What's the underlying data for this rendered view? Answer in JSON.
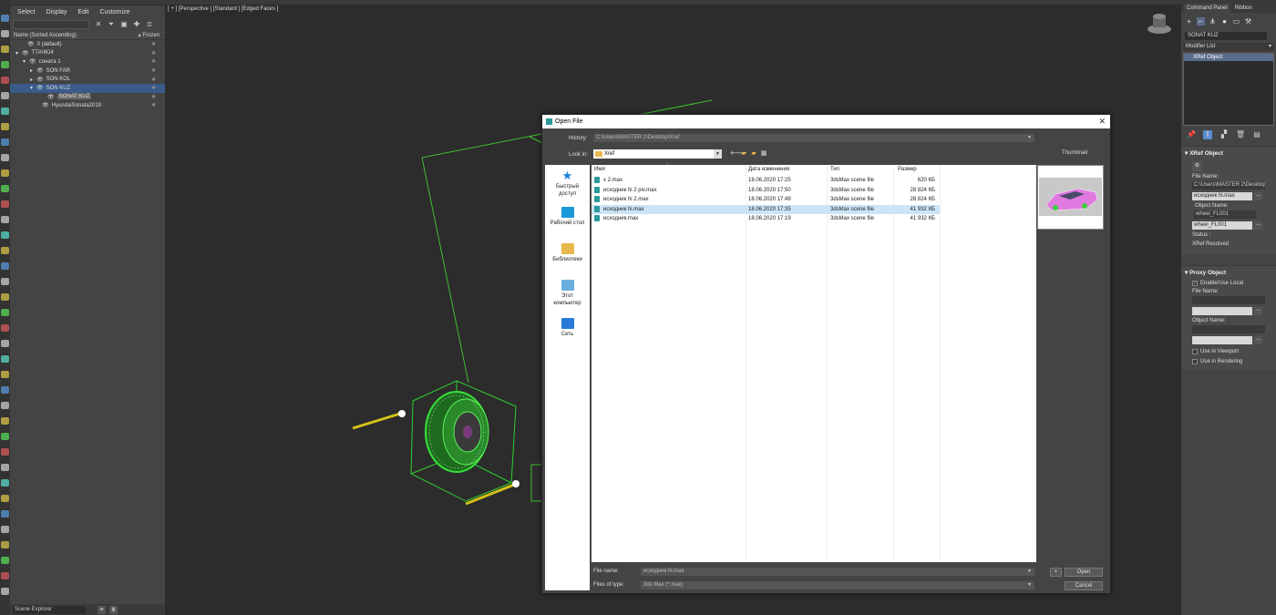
{
  "scene_explorer": {
    "menu": [
      "Select",
      "Display",
      "Edit",
      "Customize"
    ],
    "col_name": "Name (Sorted Ascending)",
    "col_frozen": "▴ Frozen",
    "rows": [
      {
        "name": "0 (default)",
        "indent": 6
      },
      {
        "name": "ТТАЧЮ4",
        "indent": 0
      },
      {
        "name": "соната 1",
        "indent": 8
      },
      {
        "name": "SON FAR",
        "indent": 16
      },
      {
        "name": "SON KOL",
        "indent": 16
      },
      {
        "name": "SON KUZ",
        "indent": 16
      },
      {
        "name": "SONAT KUZ",
        "indent": 28
      },
      {
        "name": "HyundaiSonata2019",
        "indent": 22
      }
    ],
    "footer_title": "Scene Explorer"
  },
  "viewport": {
    "label": "[ + ] [Perspective ] [Standard ] [Edged Faces ]"
  },
  "command_panel": {
    "tabs": [
      "Command Panel",
      "Ribbon"
    ],
    "object_name": "SONAT KUZ",
    "modifier_list_label": "Modifier List",
    "stack_item": "XRef Object",
    "xref_section": {
      "header": "XRef Object",
      "file_name_label": "File Name:",
      "file_name_value": "C:\\Users\\MASTER 2\\Desktop",
      "file_field": "исходник hi.max",
      "object_name_label": "Object Name:",
      "object_name_value": "wheel_FL001",
      "object_field": "wheel_FL001",
      "status_label": "Status :",
      "status_value": "XRef Resolved"
    },
    "proxy_section": {
      "header": "Proxy Object",
      "enable_label": "Enable/Use Local",
      "file_name_label": "File Name:",
      "object_name_label": "Object Name:",
      "use_viewport": "Use in Viewport",
      "use_rendering": "Use in Rendering"
    }
  },
  "dialog": {
    "title": "Open File",
    "history_label": "History:",
    "history_value": "C:\\Users\\MASTER 2\\Desktop\\Xref",
    "lookin_label": "Look in:",
    "lookin_value": "Xref",
    "thumbnail_label": "Thumbnail",
    "places": [
      "Быстрый доступ",
      "Рабочий стол",
      "Библиотеки",
      "Этот компьютер",
      "Сеть"
    ],
    "columns": [
      "Имя",
      "Дата изменения",
      "Тип",
      "Размер"
    ],
    "files": [
      {
        "name": "x 2.max",
        "date": "18.06.2020 17:25",
        "type": "3dsMax scene file",
        "size": "620 КБ",
        "selected": false
      },
      {
        "name": "исходник hi 2 piv.max",
        "date": "18.06.2020 17:50",
        "type": "3dsMax scene file",
        "size": "28 824 КБ",
        "selected": false
      },
      {
        "name": "исходник hi 2.max",
        "date": "18.06.2020 17:49",
        "type": "3dsMax scene file",
        "size": "28 824 КБ",
        "selected": false
      },
      {
        "name": "исходник hi.max",
        "date": "18.06.2020 17:35",
        "type": "3dsMax scene file",
        "size": "41 932 КБ",
        "selected": true
      },
      {
        "name": "исходник.max",
        "date": "18.06.2020 17:19",
        "type": "3dsMax scene file",
        "size": "41 932 КБ",
        "selected": false
      }
    ],
    "file_name_label": "File name:",
    "file_name_value": "исходник hi.max",
    "file_type_label": "Files of type:",
    "file_type_value": "3ds Max (*.max)",
    "plus_label": "+",
    "open_label": "Open",
    "cancel_label": "Cancel"
  }
}
